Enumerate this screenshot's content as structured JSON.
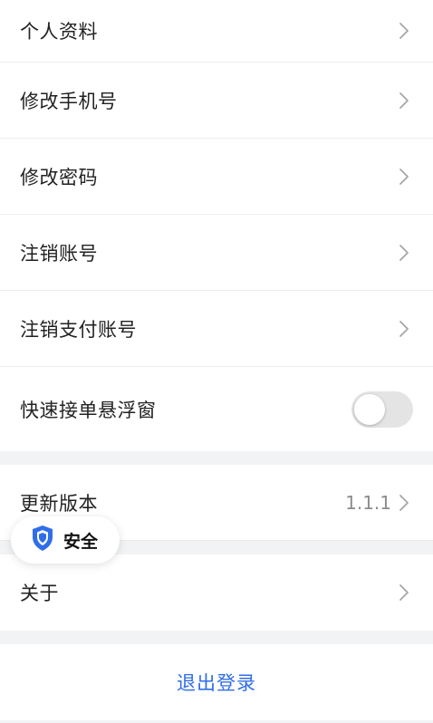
{
  "settings_group_1": {
    "items": [
      {
        "label": "个人资料"
      },
      {
        "label": "修改手机号"
      },
      {
        "label": "修改密码"
      },
      {
        "label": "注销账号"
      },
      {
        "label": "注销支付账号"
      },
      {
        "label": "快速接单悬浮窗",
        "toggle_on": false
      }
    ]
  },
  "settings_group_2": {
    "update_label": "更新版本",
    "update_value": "1.1.1",
    "about_label": "关于"
  },
  "logout_label": "退出登录",
  "security_badge": {
    "label": "安全",
    "icon": "shield-icon"
  },
  "colors": {
    "accent": "#2f6ee8",
    "shield": "#2f6ee8",
    "background": "#f2f3f5"
  }
}
